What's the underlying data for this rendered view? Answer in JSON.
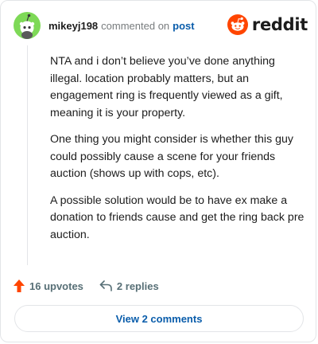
{
  "comment": {
    "username": "mikeyj198",
    "action_text": "commented on",
    "post_link": "post",
    "paragraphs": [
      "NTA and i don’t believe you’ve done anything illegal. location probably matters, but an engagement ring is frequently viewed as a gift, meaning it is your property.",
      "One thing you might consider is whether this guy could possibly cause a scene for your friends auction (shows up with cops, etc).",
      "A possible solution would be to have ex make a donation to friends cause and get the ring back pre auction."
    ]
  },
  "brand": {
    "wordmark": "reddit",
    "accent_color": "#ff4500",
    "link_color": "#0a5dab"
  },
  "actions": {
    "upvotes_label": "16 upvotes",
    "replies_label": "2 replies",
    "view_comments_label": "View 2 comments"
  },
  "icons": {
    "avatar": "snoo-avatar-icon",
    "logo": "reddit-snoo-icon",
    "upvote": "upvote-arrow-icon",
    "reply": "reply-arrow-icon"
  }
}
